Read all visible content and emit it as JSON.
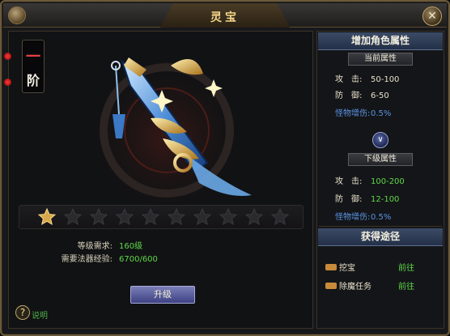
{
  "window": {
    "title": "灵宝",
    "close_symbol": "✕"
  },
  "grade": {
    "number": "一",
    "unit": "阶"
  },
  "stars": {
    "total": 10,
    "filled": 1,
    "filled_color": "#d8a84a",
    "empty_color": "#2a2a2c"
  },
  "requirements": [
    {
      "label": "等级需求:",
      "value": "160级"
    },
    {
      "label": "需要法器经验:",
      "value": "6700/600"
    }
  ],
  "upgrade_button": "升级",
  "help": {
    "icon": "?",
    "link": "说明"
  },
  "attributes": {
    "header": "增加角色属性",
    "current_title": "当前属性",
    "current": [
      {
        "key": "攻　击:",
        "value": "50-100"
      },
      {
        "key": "防　御:",
        "value": "6-50"
      },
      {
        "key": "怪物增伤:",
        "value": "0.5%"
      }
    ],
    "next_title": "下级属性",
    "next": [
      {
        "key": "攻　击:",
        "value": "100-200"
      },
      {
        "key": "防　御:",
        "value": "12-100"
      },
      {
        "key": "怪物增伤:",
        "value": "0.5%"
      }
    ],
    "arrow_symbol": "∨"
  },
  "sources": {
    "header": "获得途径",
    "items": [
      {
        "name": "挖宝",
        "action": "前往"
      },
      {
        "name": "除魔任务",
        "action": "前往"
      }
    ]
  }
}
